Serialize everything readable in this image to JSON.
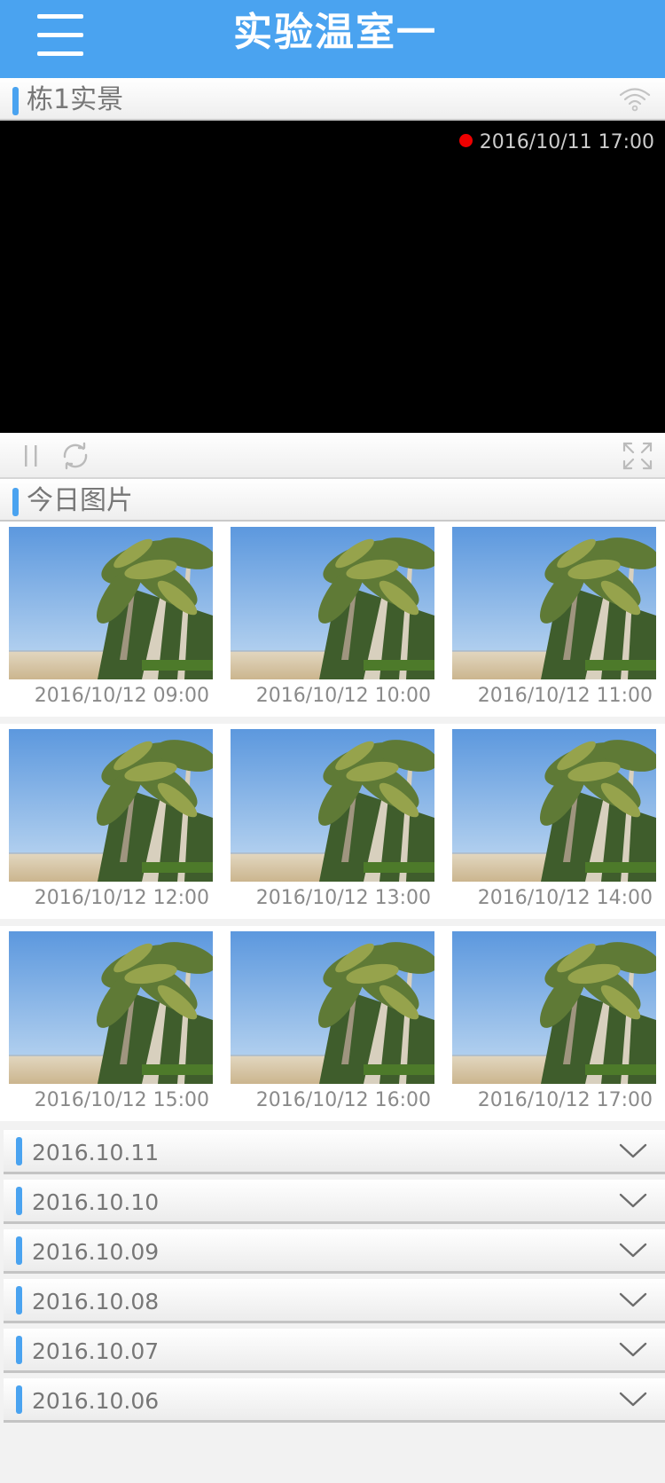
{
  "header": {
    "title": "实验温室一",
    "menu_icon": "hamburger-menu-icon",
    "color": "#4aa3f0"
  },
  "live": {
    "title": "栋1实景",
    "signal_icon": "wifi-signal-icon",
    "timestamp": "2016/10/11 17:00",
    "recording_color": "#ee0000",
    "controls": [
      "pause-icon",
      "refresh-icon",
      "fullscreen-icon"
    ]
  },
  "today": {
    "title": "今日图片",
    "photos": [
      {
        "time": "2016/10/12 09:00"
      },
      {
        "time": "2016/10/12 10:00"
      },
      {
        "time": "2016/10/12 11:00"
      },
      {
        "time": "2016/10/12 12:00"
      },
      {
        "time": "2016/10/12 13:00"
      },
      {
        "time": "2016/10/12 14:00"
      },
      {
        "time": "2016/10/12 15:00"
      },
      {
        "time": "2016/10/12 16:00"
      },
      {
        "time": "2016/10/12 17:00"
      }
    ]
  },
  "history": {
    "expand_icon": "chevron-down-icon",
    "dates": [
      "2016.10.11",
      "2016.10.10",
      "2016.10.09",
      "2016.10.08",
      "2016.10.07",
      "2016.10.06"
    ]
  }
}
